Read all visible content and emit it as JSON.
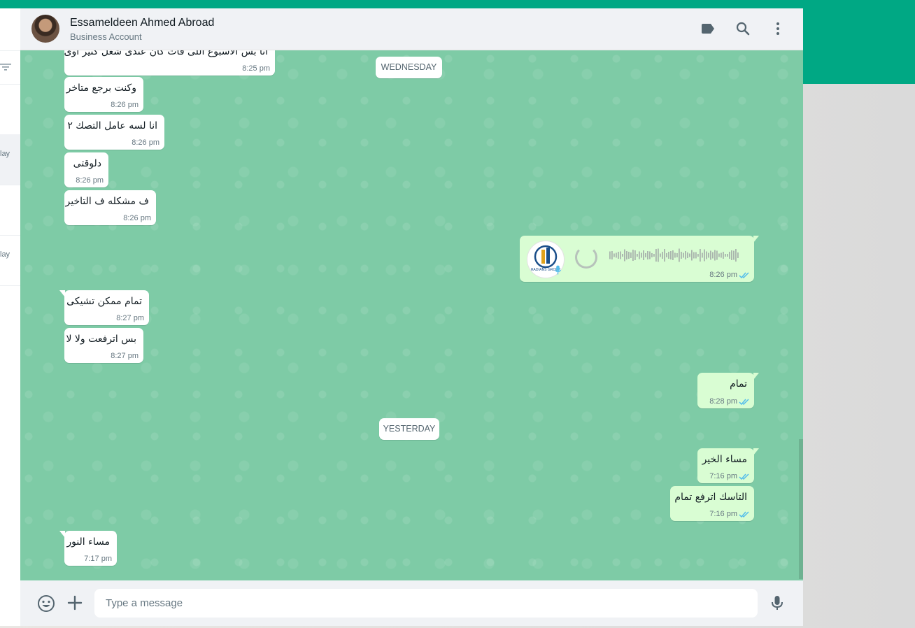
{
  "header": {
    "contact_name": "Essameldeen Ahmed Abroad",
    "contact_subtitle": "Business Account",
    "icons": [
      "label-icon",
      "search-icon",
      "menu-dots-icon"
    ]
  },
  "sidebar": {
    "day_labels": [
      "lay",
      "lay"
    ]
  },
  "date_chips": {
    "wednesday": "WEDNESDAY",
    "yesterday": "YESTERDAY"
  },
  "messages": [
    {
      "text": "انا بس الاسبوع اللى فات كان عندى شغل كتير اوى",
      "time": "8:25 pm",
      "direction": "in"
    },
    {
      "text": "وكنت برجع متاخر",
      "time": "8:26 pm",
      "direction": "in"
    },
    {
      "text": "انا لسه عامل التصك ٢",
      "time": "8:26 pm",
      "direction": "in"
    },
    {
      "text": "دلوقتى",
      "time": "8:26 pm",
      "direction": "in"
    },
    {
      "text": "ف مشكله ف التاخير",
      "time": "8:26 pm",
      "direction": "in"
    },
    {
      "type": "voice",
      "time": "8:26 pm",
      "direction": "out",
      "avatar_text": "RADIANS GROUP"
    },
    {
      "text": "تمام ممكن تشيكى",
      "time": "8:27 pm",
      "direction": "in"
    },
    {
      "text": "بس اترفعت ولا لا",
      "time": "8:27 pm",
      "direction": "in"
    },
    {
      "text": "تمام",
      "time": "8:28 pm",
      "direction": "out"
    },
    {
      "text": "مساء الخير",
      "time": "7:16 pm",
      "direction": "out"
    },
    {
      "text": "التاسك  اترفع تمام",
      "time": "7:16 pm",
      "direction": "out"
    },
    {
      "text": "مساء النور",
      "time": "7:17 pm",
      "direction": "in"
    }
  ],
  "composer": {
    "placeholder": "Type a message"
  },
  "colors": {
    "brand": "#00a884",
    "chat_bg": "#7ecba6",
    "outgoing": "#d9fdd3",
    "incoming": "#ffffff",
    "tick": "#53bdeb"
  }
}
